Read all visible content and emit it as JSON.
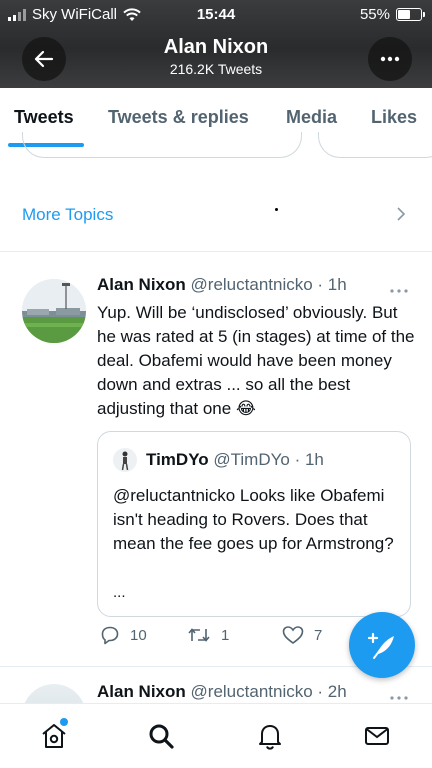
{
  "status_bar": {
    "carrier": "Sky WiFiCall",
    "time": "15:44",
    "battery_percent": "55%",
    "battery_level": 0.55
  },
  "header": {
    "title": "Alan Nixon",
    "subtitle": "216.2K Tweets",
    "back_icon": "arrow-left-icon",
    "more_icon": "more-horizontal-icon"
  },
  "tabs": [
    {
      "label": "Tweets",
      "active": true
    },
    {
      "label": "Tweets & replies",
      "active": false
    },
    {
      "label": "Media",
      "active": false
    },
    {
      "label": "Likes",
      "active": false
    }
  ],
  "more_topics": {
    "label": "More Topics"
  },
  "tweet": {
    "name": "Alan Nixon",
    "handle": "@reluctantnicko",
    "time": "· 1h",
    "text": "Yup. Will be ‘undisclosed’ obviously. But he was rated at 5 (in stages) at time of the deal. Obafemi would have been money down and extras ... so all the best adjusting that one 😂",
    "quote": {
      "name": "TimDYo",
      "handle": "@TimDYo",
      "time": "· 1h",
      "text": "@reluctantnicko Looks like Obafemi isn't heading to Rovers. Does that mean the fee goes up for Armstrong?",
      "ellipsis": "..."
    },
    "replies": "10",
    "retweets": "1",
    "likes": "7"
  },
  "tweet2": {
    "name": "Alan Nixon",
    "handle": "@reluctantnicko",
    "time": "· 2h"
  },
  "colors": {
    "accent": "#1d9bf0",
    "text": "#0f1419",
    "secondary": "#536471"
  }
}
